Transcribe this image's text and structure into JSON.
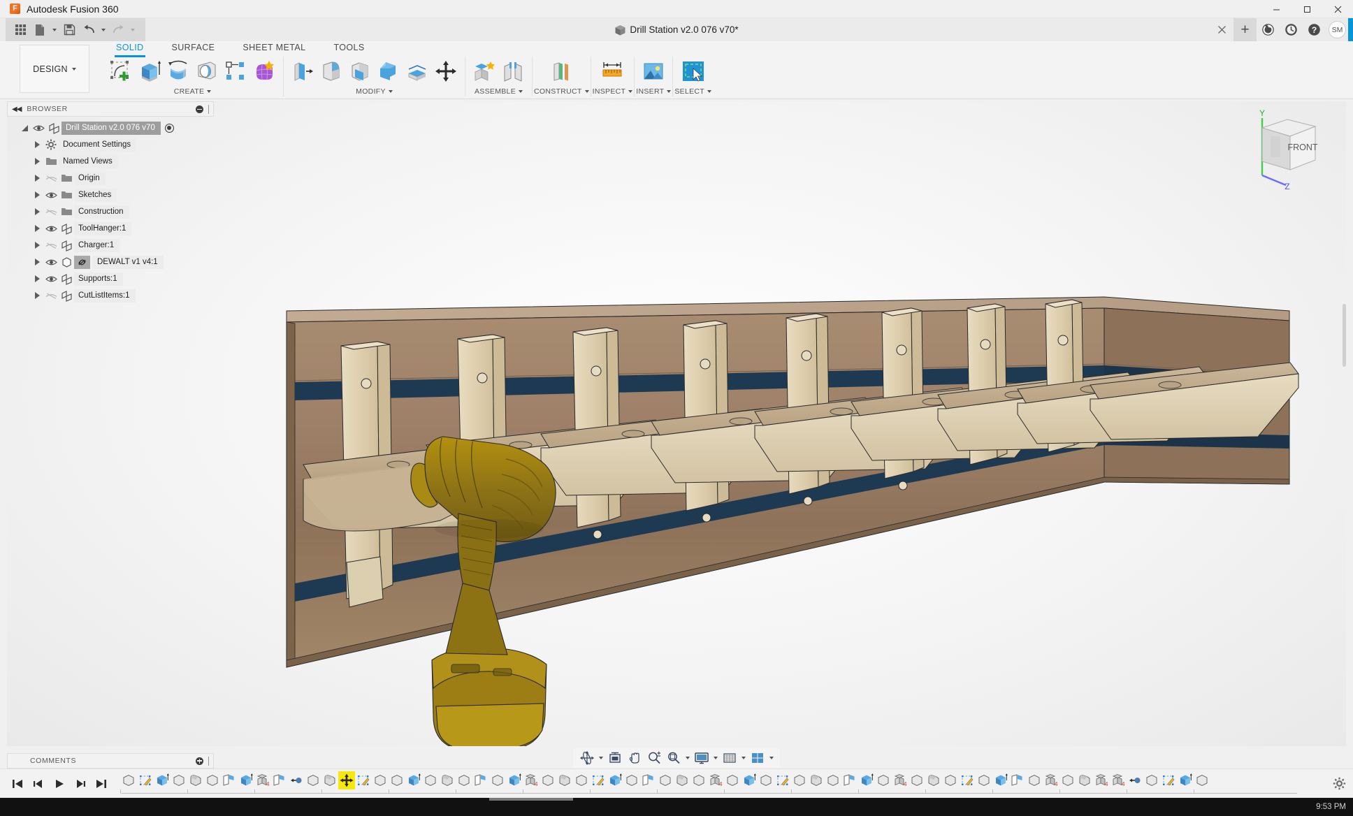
{
  "window": {
    "app_title": "Autodesk Fusion 360",
    "logo_letter": "F",
    "minimize": "─",
    "maximize": "❐",
    "close": "✕"
  },
  "quick_access": {
    "items": [
      {
        "name": "app-grid-icon",
        "label": "Show Data Panel"
      },
      {
        "name": "file-icon",
        "label": "File"
      },
      {
        "name": "save-icon",
        "label": "Save"
      },
      {
        "name": "undo-icon",
        "label": "Undo"
      },
      {
        "name": "redo-icon",
        "label": "Redo"
      }
    ]
  },
  "document_tab": {
    "title": "Drill Station v2.0 076 v70*",
    "close_label": "✕"
  },
  "tabbar_right": {
    "new_tab": "+",
    "job_status_label": "Job Status",
    "recent_label": "Recent",
    "help_label": "Help",
    "avatar_initials": "SM"
  },
  "ribbon": {
    "workspace": "DESIGN",
    "tabs": [
      {
        "label": "SOLID",
        "active": true
      },
      {
        "label": "SURFACE",
        "active": false
      },
      {
        "label": "SHEET METAL",
        "active": false
      },
      {
        "label": "TOOLS",
        "active": false
      }
    ],
    "panels": [
      {
        "label": "CREATE",
        "tools": [
          {
            "name": "create-sketch-icon",
            "label": "Create Sketch"
          },
          {
            "name": "extrude-icon",
            "label": "Extrude"
          },
          {
            "name": "revolve-icon",
            "label": "Revolve"
          },
          {
            "name": "sweep-icon",
            "label": "Sweep"
          },
          {
            "name": "pattern-icon",
            "label": "Rectangular Pattern"
          },
          {
            "name": "create-form-icon",
            "label": "Create Form"
          }
        ]
      },
      {
        "label": "MODIFY",
        "tools": [
          {
            "name": "press-pull-icon",
            "label": "Press Pull"
          },
          {
            "name": "fillet-icon",
            "label": "Fillet"
          },
          {
            "name": "chamfer-icon",
            "label": "Chamfer"
          },
          {
            "name": "shell-icon",
            "label": "Shell"
          },
          {
            "name": "split-face-icon",
            "label": "Split Face"
          },
          {
            "name": "move-copy-icon",
            "label": "Move/Copy"
          }
        ]
      },
      {
        "label": "ASSEMBLE",
        "tools": [
          {
            "name": "new-component-icon",
            "label": "New Component"
          },
          {
            "name": "joint-icon",
            "label": "Joint"
          }
        ]
      },
      {
        "label": "CONSTRUCT",
        "tools": [
          {
            "name": "offset-plane-icon",
            "label": "Offset Plane"
          }
        ]
      },
      {
        "label": "INSPECT",
        "tools": [
          {
            "name": "measure-icon",
            "label": "Measure"
          }
        ]
      },
      {
        "label": "INSERT",
        "tools": [
          {
            "name": "insert-image-icon",
            "label": "Canvas"
          }
        ]
      },
      {
        "label": "SELECT",
        "tools": [
          {
            "name": "select-window-icon",
            "label": "Select"
          }
        ]
      }
    ]
  },
  "browser": {
    "title": "BROWSER",
    "collapse_label": "◀◀",
    "tree": [
      {
        "label": "Drill Station v2.0 076 v70",
        "icon": "component-icon",
        "visible": true,
        "selected": true,
        "indent": 0,
        "activated": true
      },
      {
        "label": "Document Settings",
        "icon": "gear-icon",
        "visible": null,
        "selected": false,
        "indent": 1
      },
      {
        "label": "Named Views",
        "icon": "folder-icon",
        "visible": null,
        "selected": false,
        "indent": 1
      },
      {
        "label": "Origin",
        "icon": "folder-icon",
        "visible": false,
        "selected": false,
        "indent": 1
      },
      {
        "label": "Sketches",
        "icon": "folder-icon",
        "visible": true,
        "selected": false,
        "indent": 1
      },
      {
        "label": "Construction",
        "icon": "folder-icon",
        "visible": false,
        "selected": false,
        "indent": 1
      },
      {
        "label": "ToolHanger:1",
        "icon": "component-icon",
        "visible": true,
        "selected": false,
        "indent": 1
      },
      {
        "label": "Charger:1",
        "icon": "component-icon",
        "visible": false,
        "selected": false,
        "indent": 1
      },
      {
        "label": "DEWALT v1 v4:1",
        "icon": "body-icon",
        "visible": true,
        "selected": false,
        "indent": 1,
        "linked": true
      },
      {
        "label": "Supports:1",
        "icon": "component-icon",
        "visible": true,
        "selected": false,
        "indent": 1
      },
      {
        "label": "CutListItems:1",
        "icon": "component-icon",
        "visible": false,
        "selected": false,
        "indent": 1
      }
    ]
  },
  "comments": {
    "title": "COMMENTS"
  },
  "viewcube": {
    "face": "FRONT",
    "axis_y": "Y",
    "axis_z": "Z"
  },
  "navbar": {
    "items": [
      {
        "name": "orbit-icon",
        "label": "Orbit",
        "caret": true
      },
      {
        "name": "look-at-icon",
        "label": "Look At",
        "caret": false
      },
      {
        "name": "pan-icon",
        "label": "Pan",
        "caret": false
      },
      {
        "name": "zoom-icon",
        "label": "Zoom",
        "caret": false
      },
      {
        "name": "fit-icon",
        "label": "Fit",
        "caret": true
      },
      {
        "name": "display-settings-icon",
        "label": "Display Settings",
        "caret": true
      },
      {
        "name": "grid-snaps-icon",
        "label": "Grid and Snaps",
        "caret": true
      },
      {
        "name": "viewports-icon",
        "label": "Viewports",
        "caret": true
      }
    ]
  },
  "timeline": {
    "playback": [
      {
        "name": "go-to-beginning-icon",
        "label": "Go to beginning"
      },
      {
        "name": "step-back-icon",
        "label": "Step back"
      },
      {
        "name": "play-icon",
        "label": "Play"
      },
      {
        "name": "step-forward-icon",
        "label": "Step forward"
      },
      {
        "name": "go-to-end-icon",
        "label": "Go to end"
      }
    ],
    "features": [
      {
        "name": "body-feature",
        "type": "body",
        "selected": false
      },
      {
        "name": "sketch-feature",
        "type": "sketch",
        "selected": false
      },
      {
        "name": "extrude-feature",
        "type": "extrude",
        "selected": false
      },
      {
        "name": "body-feature",
        "type": "body",
        "selected": false
      },
      {
        "name": "fillet-feature",
        "type": "fillet",
        "selected": false
      },
      {
        "name": "body-feature",
        "type": "body",
        "selected": false
      },
      {
        "name": "plane-feature",
        "type": "plane",
        "selected": false
      },
      {
        "name": "extrude-feature",
        "type": "extrude",
        "selected": false
      },
      {
        "name": "component-feature",
        "type": "component",
        "selected": false
      },
      {
        "name": "plane-feature",
        "type": "plane",
        "selected": false
      },
      {
        "name": "joint-feature",
        "type": "joint",
        "selected": false
      },
      {
        "name": "body-feature",
        "type": "body",
        "selected": false
      },
      {
        "name": "fillet-feature",
        "type": "fillet",
        "selected": false
      },
      {
        "name": "move-feature",
        "type": "move",
        "selected": true
      },
      {
        "name": "sketch-feature",
        "type": "sketch",
        "selected": false
      },
      {
        "name": "body-feature",
        "type": "body",
        "selected": false
      },
      {
        "name": "body-feature",
        "type": "body",
        "selected": false
      },
      {
        "name": "extrude-feature",
        "type": "extrude",
        "selected": false
      },
      {
        "name": "body-feature",
        "type": "body",
        "selected": false
      },
      {
        "name": "fillet-feature",
        "type": "fillet",
        "selected": false
      },
      {
        "name": "body-feature",
        "type": "body",
        "selected": false
      },
      {
        "name": "plane-feature",
        "type": "plane",
        "selected": false
      },
      {
        "name": "body-feature",
        "type": "body",
        "selected": false
      },
      {
        "name": "extrude-feature",
        "type": "extrude",
        "selected": false
      },
      {
        "name": "component-feature",
        "type": "component",
        "selected": false
      },
      {
        "name": "body-feature",
        "type": "body",
        "selected": false
      },
      {
        "name": "fillet-feature",
        "type": "fillet",
        "selected": false
      },
      {
        "name": "body-feature",
        "type": "body",
        "selected": false
      },
      {
        "name": "sketch-feature",
        "type": "sketch",
        "selected": false
      },
      {
        "name": "extrude-feature",
        "type": "extrude",
        "selected": false
      },
      {
        "name": "body-feature",
        "type": "body",
        "selected": false
      },
      {
        "name": "plane-feature",
        "type": "plane",
        "selected": false
      },
      {
        "name": "body-feature",
        "type": "body",
        "selected": false
      },
      {
        "name": "fillet-feature",
        "type": "fillet",
        "selected": false
      },
      {
        "name": "body-feature",
        "type": "body",
        "selected": false
      },
      {
        "name": "component-feature",
        "type": "component",
        "selected": false
      },
      {
        "name": "body-feature",
        "type": "body",
        "selected": false
      },
      {
        "name": "extrude-feature",
        "type": "extrude",
        "selected": false
      },
      {
        "name": "body-feature",
        "type": "body",
        "selected": false
      },
      {
        "name": "sketch-feature",
        "type": "sketch",
        "selected": false
      },
      {
        "name": "body-feature",
        "type": "body",
        "selected": false
      },
      {
        "name": "fillet-feature",
        "type": "fillet",
        "selected": false
      },
      {
        "name": "body-feature",
        "type": "body",
        "selected": false
      },
      {
        "name": "plane-feature",
        "type": "plane",
        "selected": false
      },
      {
        "name": "extrude-feature",
        "type": "extrude",
        "selected": false
      },
      {
        "name": "body-feature",
        "type": "body",
        "selected": false
      },
      {
        "name": "component-feature",
        "type": "component",
        "selected": false
      },
      {
        "name": "body-feature",
        "type": "body",
        "selected": false
      },
      {
        "name": "fillet-feature",
        "type": "fillet",
        "selected": false
      },
      {
        "name": "body-feature",
        "type": "body",
        "selected": false
      },
      {
        "name": "sketch-feature",
        "type": "sketch",
        "selected": false
      },
      {
        "name": "body-feature",
        "type": "body",
        "selected": false
      },
      {
        "name": "extrude-feature",
        "type": "extrude",
        "selected": false
      },
      {
        "name": "plane-feature",
        "type": "plane",
        "selected": false
      },
      {
        "name": "body-feature",
        "type": "body",
        "selected": false
      },
      {
        "name": "component-feature",
        "type": "component",
        "selected": false
      },
      {
        "name": "body-feature",
        "type": "body",
        "selected": false
      },
      {
        "name": "fillet-feature",
        "type": "fillet",
        "selected": false
      },
      {
        "name": "component-feature",
        "type": "component",
        "selected": false
      },
      {
        "name": "component-feature",
        "type": "component",
        "selected": false
      },
      {
        "name": "joint-feature",
        "type": "joint",
        "selected": false
      },
      {
        "name": "body-feature",
        "type": "body",
        "selected": false
      },
      {
        "name": "sketch-feature",
        "type": "sketch",
        "selected": false
      },
      {
        "name": "extrude-feature",
        "type": "extrude",
        "selected": false
      },
      {
        "name": "body-feature",
        "type": "body",
        "selected": false
      }
    ],
    "settings_label": "Timeline Settings"
  },
  "status": {
    "time": "9:53 PM"
  },
  "model": {
    "name": "Drill Station wall rack",
    "board_color": "#9c7f66",
    "board_dark": "#6b523f",
    "hanger_color": "#e6d8bc",
    "stripe_color": "#1d3a52",
    "drill_color": "#9a7b16",
    "hanger_count": 8
  },
  "theme": {
    "accent": "#0696d7",
    "ribbon_bg": "#f3f3f3",
    "panel_bg": "#f2f2f2",
    "status_bg": "#111111",
    "timeline_selected": "#f6e80a"
  }
}
